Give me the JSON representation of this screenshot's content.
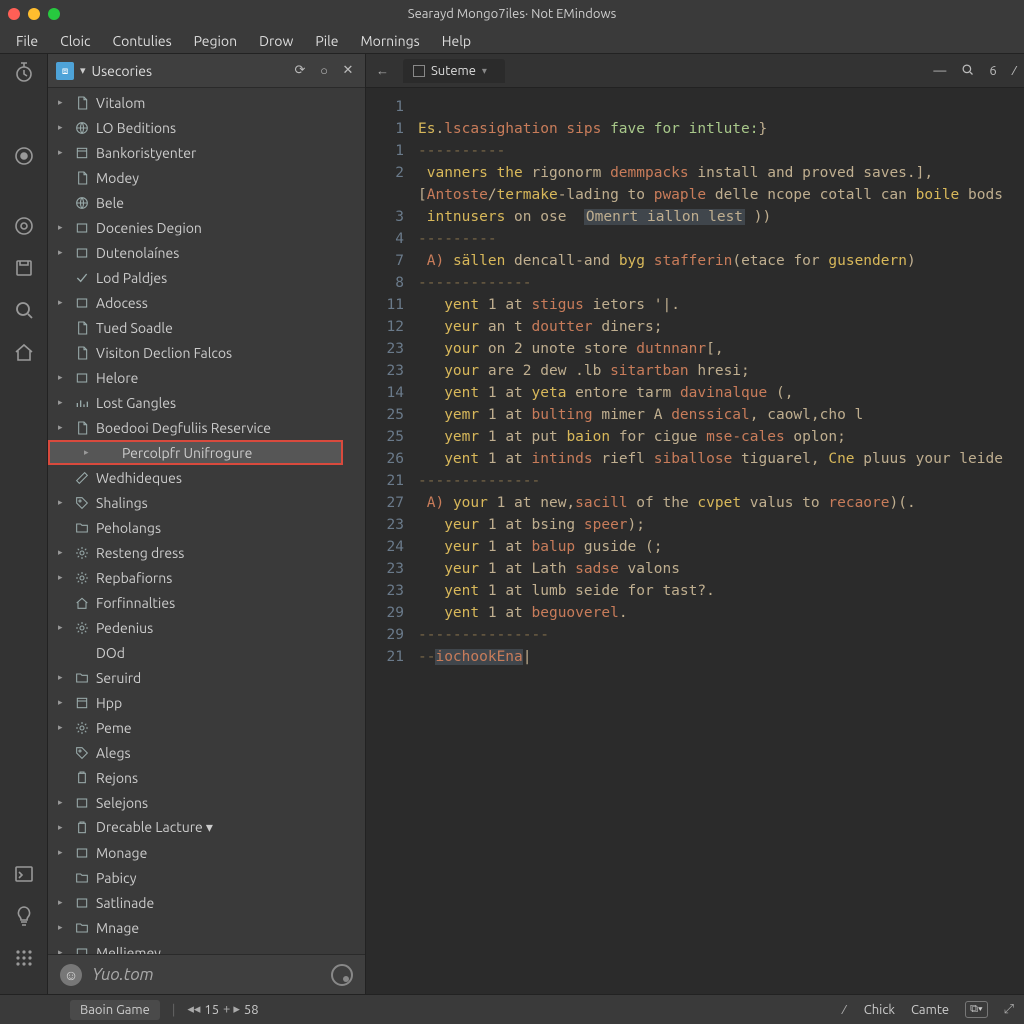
{
  "title": "Searayd Mongo7iles· Not EMindows",
  "menu": [
    "File",
    "Cloic",
    "Contulies",
    "Pegion",
    "Drow",
    "Pile",
    "Mornings",
    "Help"
  ],
  "sidebar": {
    "header_label": "Usecories",
    "footer_user": "Yuo.tom",
    "items": [
      {
        "label": "Vitalom",
        "icon": "file",
        "expandable": true
      },
      {
        "label": "LO Beditions",
        "icon": "globe",
        "expandable": true
      },
      {
        "label": "Bankoristyenter",
        "icon": "win",
        "expandable": true
      },
      {
        "label": "Modey",
        "icon": "file",
        "expandable": false,
        "leaf": true
      },
      {
        "label": "Bele",
        "icon": "globe",
        "expandable": false,
        "leaf": true
      },
      {
        "label": "Docenies Degion",
        "icon": "box",
        "expandable": true
      },
      {
        "label": "Dutenolaínes",
        "icon": "box",
        "expandable": true
      },
      {
        "label": "Lod Paldjes",
        "icon": "check",
        "expandable": false,
        "leaf": true
      },
      {
        "label": "Adocess",
        "icon": "box",
        "expandable": true
      },
      {
        "label": "Tued Soadle",
        "icon": "file",
        "expandable": false,
        "leaf": true
      },
      {
        "label": "Visiton Declion Falcos",
        "icon": "file",
        "expandable": false,
        "leaf": true
      },
      {
        "label": "Helore",
        "icon": "box",
        "expandable": true
      },
      {
        "label": "Lost Gangles",
        "icon": "bars",
        "expandable": true
      },
      {
        "label": "Boedooi Degfuliis Reservice",
        "icon": "file",
        "expandable": true
      },
      {
        "label": "Percolpfr Unifrogure",
        "icon": "",
        "expandable": true,
        "selected": true
      },
      {
        "label": "Wedhideques",
        "icon": "ruler",
        "expandable": false,
        "leaf": true
      },
      {
        "label": "Shalings",
        "icon": "tag",
        "expandable": true
      },
      {
        "label": "Peholangs",
        "icon": "folder",
        "expandable": false,
        "leaf": true
      },
      {
        "label": "Resteng dress",
        "icon": "gear",
        "expandable": true
      },
      {
        "label": "Repbafiorns",
        "icon": "gear",
        "expandable": true
      },
      {
        "label": "Forfinnalties",
        "icon": "home",
        "expandable": false,
        "leaf": true
      },
      {
        "label": "Pedenius",
        "icon": "gear",
        "expandable": true
      },
      {
        "label": "DOd",
        "icon": "",
        "expandable": false,
        "leaf": true
      },
      {
        "label": "Seruird",
        "icon": "folder",
        "expandable": true
      },
      {
        "label": "Hpp",
        "icon": "win",
        "expandable": true
      },
      {
        "label": "Peme",
        "icon": "gear",
        "expandable": true
      },
      {
        "label": "Alegs",
        "icon": "tag",
        "expandable": false,
        "leaf": true
      },
      {
        "label": "Rejons",
        "icon": "clip",
        "expandable": false,
        "leaf": true
      },
      {
        "label": "Selejons",
        "icon": "box",
        "expandable": true
      },
      {
        "label": "Drecable Lacture ▾",
        "icon": "clip",
        "expandable": true
      },
      {
        "label": "Monage",
        "icon": "box",
        "expandable": true
      },
      {
        "label": "Pabicy",
        "icon": "folder",
        "expandable": false,
        "leaf": true
      },
      {
        "label": "Satlinade",
        "icon": "box",
        "expandable": true
      },
      {
        "label": "Mnage",
        "icon": "folder",
        "expandable": true
      },
      {
        "label": "Melliemey",
        "icon": "box",
        "expandable": true
      }
    ]
  },
  "editor": {
    "tab_label": "Suteme",
    "right_number": "6",
    "code": {
      "gutter": [
        "1",
        "1",
        "1",
        "2",
        "",
        "3",
        "4",
        "7",
        "8",
        "11",
        "12",
        "23",
        "23",
        "14",
        "25",
        "25",
        "26",
        "21",
        "27",
        "23",
        "24",
        "23",
        "23",
        "29",
        "29",
        "21"
      ],
      "lines": [
        "",
        "<span class='id'>Es</span>.<span class='kw'>lscasighation sips</span> <span class='str'>fave for intlute:</span>}",
        "<span class='dash'>----------</span>",
        " <span class='id'>vanners the</span> rigonorm <span class='kw'>demmpacks</span> install and proved saves.],",
        "[<span class='kw'>Antoste</span>/<span class='id'>termake</span>-lading to <span class='kw'>pwaple</span> delle ncope cotall can <span class='id'>boile</span> bods",
        " <span class='id'>intnusers</span> on ose  <span class='box'>Omenrt iallon lest</span> ))",
        "<span class='dash'>---------</span>",
        " <span class='kw'>A)</span> <span class='id'>sällen</span> dencall-and <span class='id'>byg</span> <span class='kw'>stafferin</span>(etace for <span class='id'>gusendern</span>)",
        "<span class='dash'>-------------</span>",
        "   <span class='id'>yent</span> 1 at <span class='kw'>stigus</span> ietors '|.",
        "   <span class='id'>yeur</span> an t <span class='kw'>doutter</span> diners;",
        "   <span class='id'>your</span> on 2 unote store <span class='kw'>dutnnanr</span>[,",
        "   <span class='id'>your</span> are 2 dew .lb <span class='kw'>sitartban</span> hresi;",
        "   <span class='id'>yent</span> 1 at <span class='id'>yeta</span> entore tarm <span class='kw'>davinalque</span> (,",
        "   <span class='id'>yemr</span> 1 at <span class='kw'>bulting</span> mimer A <span class='kw'>denssical</span>, caowl,cho l",
        "   <span class='id'>yemr</span> 1 at put <span class='id'>baion</span> for cigue <span class='kw'>mse-cales</span> oplon;",
        "   <span class='id'>yent</span> 1 at <span class='kw'>intinds</span> riefl <span class='kw'>siballose</span> tiguarel, <span class='id'>Cne</span> pluus your leide",
        "<span class='dash'>--------------</span>",
        " <span class='kw'>A)</span> <span class='id'>your</span> 1 at new,<span class='kw'>sacill</span> of the <span class='id'>cvpet</span> valus to <span class='kw'>recaore</span>)(.",
        "   <span class='id'>yeur</span> 1 at bsing <span class='kw'>speer</span>);",
        "   <span class='id'>yeur</span> 1 at <span class='kw'>balup</span> guside (;",
        "   <span class='id'>yeur</span> 1 at Lath <span class='kw'>sadse</span> valons",
        "   <span class='id'>yent</span> 1 at lumb seide for tast?.",
        "   <span class='id'>yent</span> 1 at <span class='kw'>beguoverel</span>.",
        "<span class='dash'>---------------</span>",
        "<span class='dash'>--</span><span class='hlend'>iochookEna</span>|"
      ]
    }
  },
  "status": {
    "chip": "Baoin Game",
    "pager_current": "15",
    "pager_total": "58",
    "chick": "Chick",
    "camte": "Camte"
  }
}
